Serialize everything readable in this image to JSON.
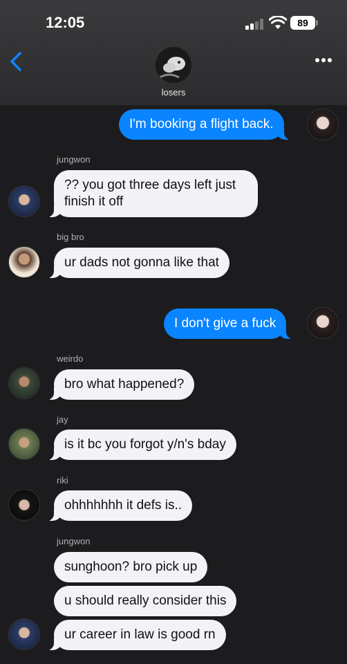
{
  "status": {
    "time": "12:05",
    "battery": "89"
  },
  "header": {
    "group_name": "losers"
  },
  "messages": {
    "m1": "I'm booking a flight back.",
    "m2": "?? you got three days left just finish it off",
    "m3": "ur dads not gonna like that",
    "m4": "I don't give a fuck",
    "m5": "bro what happened?",
    "m6": "is it bc you forgot y/n's bday",
    "m7": "ohhhhhhh it defs is..",
    "m8": "sunghoon? bro pick up",
    "m9": "u should really consider this",
    "m10": "ur career in law is good rn"
  },
  "senders": {
    "s2": "jungwon",
    "s3": "big bro",
    "s5": "weirdo",
    "s6": "jay",
    "s7": "riki",
    "s8": "jungwon"
  },
  "colors": {
    "outgoing": "#0a84ff",
    "incoming": "#f2f2f7",
    "background": "#1c1c1e"
  },
  "icons": [
    "chevron-left-icon",
    "more-icon",
    "signal-icon",
    "wifi-icon",
    "battery-icon"
  ]
}
